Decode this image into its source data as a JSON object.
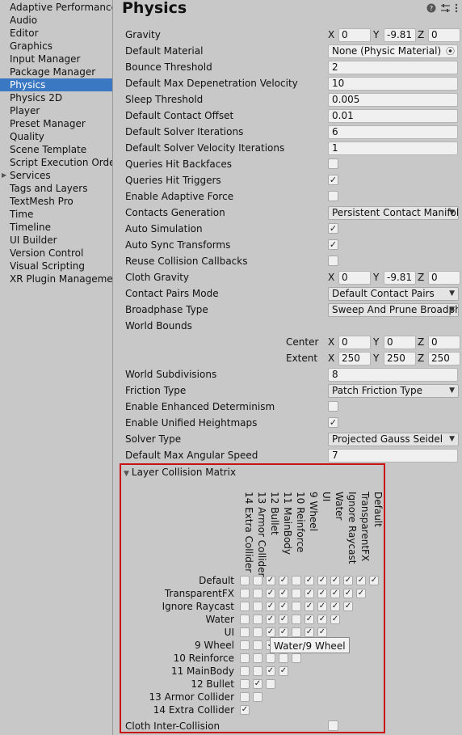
{
  "sidebar": {
    "items": [
      {
        "label": "Adaptive Performance"
      },
      {
        "label": "Audio"
      },
      {
        "label": "Editor"
      },
      {
        "label": "Graphics"
      },
      {
        "label": "Input Manager"
      },
      {
        "label": "Package Manager"
      },
      {
        "label": "Physics",
        "selected": true
      },
      {
        "label": "Physics 2D"
      },
      {
        "label": "Player"
      },
      {
        "label": "Preset Manager"
      },
      {
        "label": "Quality"
      },
      {
        "label": "Scene Template"
      },
      {
        "label": "Script Execution Order"
      },
      {
        "label": "Services",
        "expandable": true
      },
      {
        "label": "Tags and Layers"
      },
      {
        "label": "TextMesh Pro"
      },
      {
        "label": "Time"
      },
      {
        "label": "Timeline"
      },
      {
        "label": "UI Builder"
      },
      {
        "label": "Version Control"
      },
      {
        "label": "Visual Scripting"
      },
      {
        "label": "XR Plugin Management"
      }
    ]
  },
  "header": {
    "title": "Physics",
    "help_icon": "help-icon",
    "preset_icon": "sliders-icon",
    "menu_icon": "kebab-menu-icon"
  },
  "axis_labels": {
    "x": "X",
    "y": "Y",
    "z": "Z"
  },
  "world_bounds_labels": {
    "center": "Center",
    "extent": "Extent"
  },
  "settings": {
    "gravity": {
      "label": "Gravity",
      "x": "0",
      "y": "-9.81",
      "z": "0"
    },
    "default_material": {
      "label": "Default Material",
      "value": "None (Physic Material)"
    },
    "bounce_threshold": {
      "label": "Bounce Threshold",
      "value": "2"
    },
    "max_depenetration": {
      "label": "Default Max Depenetration Velocity",
      "value": "10"
    },
    "sleep_threshold": {
      "label": "Sleep Threshold",
      "value": "0.005"
    },
    "contact_offset": {
      "label": "Default Contact Offset",
      "value": "0.01"
    },
    "solver_iterations": {
      "label": "Default Solver Iterations",
      "value": "6"
    },
    "solver_velocity_iterations": {
      "label": "Default Solver Velocity Iterations",
      "value": "1"
    },
    "queries_hit_backfaces": {
      "label": "Queries Hit Backfaces",
      "checked": false
    },
    "queries_hit_triggers": {
      "label": "Queries Hit Triggers",
      "checked": true
    },
    "adaptive_force": {
      "label": "Enable Adaptive Force",
      "checked": false
    },
    "contacts_generation": {
      "label": "Contacts Generation",
      "value": "Persistent Contact Manifold"
    },
    "auto_simulation": {
      "label": "Auto Simulation",
      "checked": true
    },
    "auto_sync_transforms": {
      "label": "Auto Sync Transforms",
      "checked": true
    },
    "reuse_collision_callbacks": {
      "label": "Reuse Collision Callbacks",
      "checked": false
    },
    "cloth_gravity": {
      "label": "Cloth Gravity",
      "x": "0",
      "y": "-9.81",
      "z": "0"
    },
    "contact_pairs_mode": {
      "label": "Contact Pairs Mode",
      "value": "Default Contact Pairs"
    },
    "broadphase_type": {
      "label": "Broadphase Type",
      "value": "Sweep And Prune Broadphase"
    },
    "world_bounds": {
      "label": "World Bounds",
      "center": {
        "x": "0",
        "y": "0",
        "z": "0"
      },
      "extent": {
        "x": "250",
        "y": "250",
        "z": "250"
      }
    },
    "world_subdivisions": {
      "label": "World Subdivisions",
      "value": "8"
    },
    "friction_type": {
      "label": "Friction Type",
      "value": "Patch Friction Type"
    },
    "enhanced_determinism": {
      "label": "Enable Enhanced Determinism",
      "checked": false
    },
    "unified_heightmaps": {
      "label": "Enable Unified Heightmaps",
      "checked": true
    },
    "solver_type": {
      "label": "Solver Type",
      "value": "Projected Gauss Seidel"
    },
    "max_angular_speed": {
      "label": "Default Max Angular Speed",
      "value": "7"
    },
    "cloth_inter_collision": {
      "label": "Cloth Inter-Collision",
      "checked": false
    }
  },
  "matrix": {
    "title": "Layer Collision Matrix",
    "rows": [
      "Default",
      "TransparentFX",
      "Ignore Raycast",
      "Water",
      "UI",
      "9 Wheel",
      "10 Reinforce",
      "11 MainBody",
      "12 Bullet",
      "13 Armor Collider",
      "14 Extra Collider"
    ],
    "columns": [
      "14 Extra Collider",
      "13 Armor Collider",
      "12 Bullet",
      "11 MainBody",
      "10 Reinforce",
      "9 Wheel",
      "UI",
      "Water",
      "Ignore Raycast",
      "TransparentFX",
      "Default"
    ],
    "checks": [
      [
        0,
        0,
        1,
        1,
        0,
        1,
        1,
        1,
        1,
        1,
        1
      ],
      [
        0,
        0,
        1,
        1,
        0,
        1,
        1,
        1,
        1,
        1
      ],
      [
        0,
        0,
        1,
        1,
        0,
        1,
        1,
        1,
        1
      ],
      [
        0,
        0,
        1,
        1,
        0,
        1,
        1,
        1
      ],
      [
        0,
        0,
        1,
        1,
        0,
        1,
        1
      ],
      [
        0,
        0,
        1,
        1,
        0,
        1
      ],
      [
        0,
        0,
        0,
        0,
        0
      ],
      [
        0,
        0,
        1,
        1
      ],
      [
        0,
        1,
        0
      ],
      [
        0,
        0
      ],
      [
        1
      ]
    ],
    "tooltip": "Water/9 Wheel"
  }
}
